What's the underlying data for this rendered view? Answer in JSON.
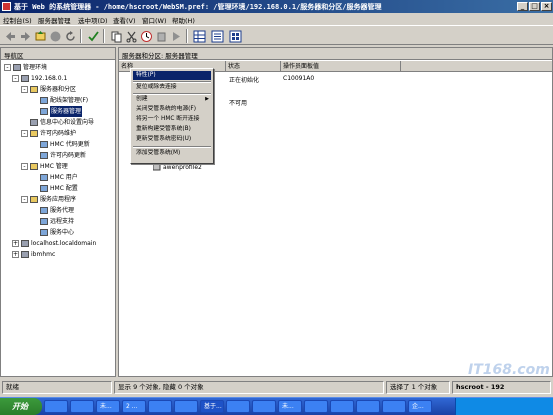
{
  "window": {
    "title": "基于 Web 的系统管理器 - /home/hscroot/WebSM.pref: /管理环境/192.168.0.1/服务器和分区/服务器管理",
    "min": "_",
    "max": "□",
    "close": "×"
  },
  "menubar": [
    "控制台(S)",
    "服务器管理",
    "选中项(D)",
    "查看(V)",
    "窗口(W)",
    "帮助(H)"
  ],
  "toolbar_icons": [
    "back-icon",
    "forward-icon",
    "up-icon",
    "stop-icon",
    "refresh-icon",
    "check-icon",
    "copy-icon",
    "cut-icon",
    "clock-icon",
    "delete-icon",
    "play-icon",
    "grid-icon",
    "list-icon",
    "tile-icon"
  ],
  "nav": {
    "header": "导航区",
    "tree": [
      {
        "label": "管理环境",
        "expander": "-",
        "level": 0
      },
      {
        "label": "192.168.0.1",
        "expander": "-",
        "level": 1
      },
      {
        "label": "服务器和分区",
        "expander": "-",
        "level": 2
      },
      {
        "label": "配线架管理(F)",
        "expander": "",
        "level": 3
      },
      {
        "label": "服务器管理",
        "expander": "",
        "level": 3,
        "selected": true
      },
      {
        "label": "信息中心和设置向导",
        "expander": "",
        "level": 2
      },
      {
        "label": "许可内码维护",
        "expander": "-",
        "level": 2
      },
      {
        "label": "HMC 代码更新",
        "expander": "",
        "level": 3
      },
      {
        "label": "许可内码更新",
        "expander": "",
        "level": 3
      },
      {
        "label": "HMC 管理",
        "expander": "-",
        "level": 2
      },
      {
        "label": "HMC 用户",
        "expander": "",
        "level": 3
      },
      {
        "label": "HMC 配置",
        "expander": "",
        "level": 3
      },
      {
        "label": "服务应用程序",
        "expander": "-",
        "level": 2
      },
      {
        "label": "服务代理",
        "expander": "",
        "level": 3
      },
      {
        "label": "远程支持",
        "expander": "",
        "level": 3
      },
      {
        "label": "服务中心",
        "expander": "",
        "level": 3
      },
      {
        "label": "localhost.localdomain",
        "expander": "+",
        "level": 1
      },
      {
        "label": "ibmhmc",
        "expander": "+",
        "level": 1
      }
    ]
  },
  "main": {
    "header": "服务器和分区: 服务器管理",
    "columns": [
      "名称",
      "状态",
      "操作员面板值"
    ],
    "rows": [
      {
        "status": "正在初始化",
        "panel": "C10091A0"
      },
      {
        "status": "不可用",
        "panel": ""
      }
    ],
    "profile_label": "awenprofile2"
  },
  "context_menu": [
    {
      "label": "特性(P)",
      "highlighted": true
    },
    {
      "label": "复位或除去连接"
    },
    {
      "label": "创建",
      "submenu": true
    },
    {
      "label": "关闭受管系统的电源(F)"
    },
    {
      "label": "将另一个 HMC 断开连接"
    },
    {
      "label": "重新构建受管系统(B)"
    },
    {
      "label": "更新受管系统密码(U)"
    },
    {
      "label": "添加受管系统(M)"
    }
  ],
  "status": {
    "left": "就绪",
    "middle": "显示 9 个对象, 隐藏 0 个对象",
    "selected": "选择了 1 个对象",
    "host": "hscroot - 192"
  },
  "taskbar": {
    "start": "开始",
    "tasks": [
      "",
      "",
      "未...",
      "2 ...",
      "",
      "",
      "基于...",
      "",
      "",
      "未...",
      "",
      "",
      "",
      "",
      "企..."
    ],
    "clock": ""
  },
  "watermark": "IT168.com"
}
